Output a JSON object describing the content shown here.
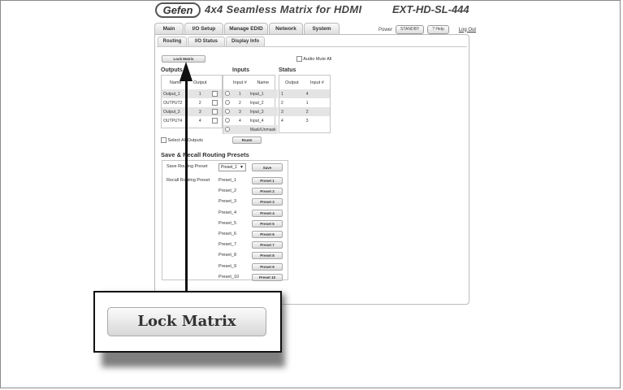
{
  "header": {
    "logo": "Gefen",
    "title": "4x4 Seamless Matrix for HDMI",
    "model": "EXT-HD-SL-444"
  },
  "tabs": [
    "Main",
    "I/O Setup",
    "Manage EDID",
    "Network",
    "System"
  ],
  "top_right": {
    "power_label": "Power",
    "standby": "STANDBY",
    "help": "? Help",
    "logout": "Log Out"
  },
  "subtabs": [
    "Routing",
    "I/O Status",
    "Display Info"
  ],
  "lock_matrix": "Lock Matrix",
  "audio_mute_all": "Audio Mute All",
  "sections": {
    "outputs": "Outputs",
    "inputs": "Inputs",
    "status": "Status"
  },
  "outputs_table": {
    "headers": [
      "Name",
      "Output"
    ],
    "rows": [
      {
        "name": "Output_1",
        "output": "1"
      },
      {
        "name": "OUTPUT2",
        "output": "2"
      },
      {
        "name": "Output_3",
        "output": "3"
      },
      {
        "name": "OUTPUT4",
        "output": "4"
      }
    ]
  },
  "inputs_table": {
    "headers": [
      "Input #",
      "Name"
    ],
    "rows": [
      {
        "num": "1",
        "name": "Input_1"
      },
      {
        "num": "2",
        "name": "Input_2"
      },
      {
        "num": "3",
        "name": "Input_3"
      },
      {
        "num": "4",
        "name": "Input_4"
      },
      {
        "num": "",
        "name": "Mask/Unmask"
      }
    ]
  },
  "status_table": {
    "headers": [
      "Output",
      "Input #"
    ],
    "rows": [
      {
        "output": "1",
        "input": "4"
      },
      {
        "output": "2",
        "input": "1"
      },
      {
        "output": "3",
        "input": "2"
      },
      {
        "output": "4",
        "input": "3"
      }
    ]
  },
  "select_all_outputs": "Select All Outputs",
  "route_button": "Route",
  "presets": {
    "heading": "Save & Recall Routing Presets",
    "save_label": "Save Routing Preset",
    "save_select": "Preset_1",
    "save_button": "Save",
    "recall_label": "Recall Routing Preset",
    "items": [
      {
        "name": "Preset_1",
        "button": "Preset 1"
      },
      {
        "name": "Preset_2",
        "button": "Preset 2"
      },
      {
        "name": "Preset_3",
        "button": "Preset 3"
      },
      {
        "name": "Preset_4",
        "button": "Preset 4"
      },
      {
        "name": "Preset_5",
        "button": "Preset 5"
      },
      {
        "name": "Preset_6",
        "button": "Preset 6"
      },
      {
        "name": "Preset_7",
        "button": "Preset 7"
      },
      {
        "name": "Preset_8",
        "button": "Preset 8"
      },
      {
        "name": "Preset_9",
        "button": "Preset 9"
      },
      {
        "name": "Preset_10",
        "button": "Preset 10"
      }
    ]
  },
  "callout": {
    "zoom_label": "Lock Matrix"
  }
}
